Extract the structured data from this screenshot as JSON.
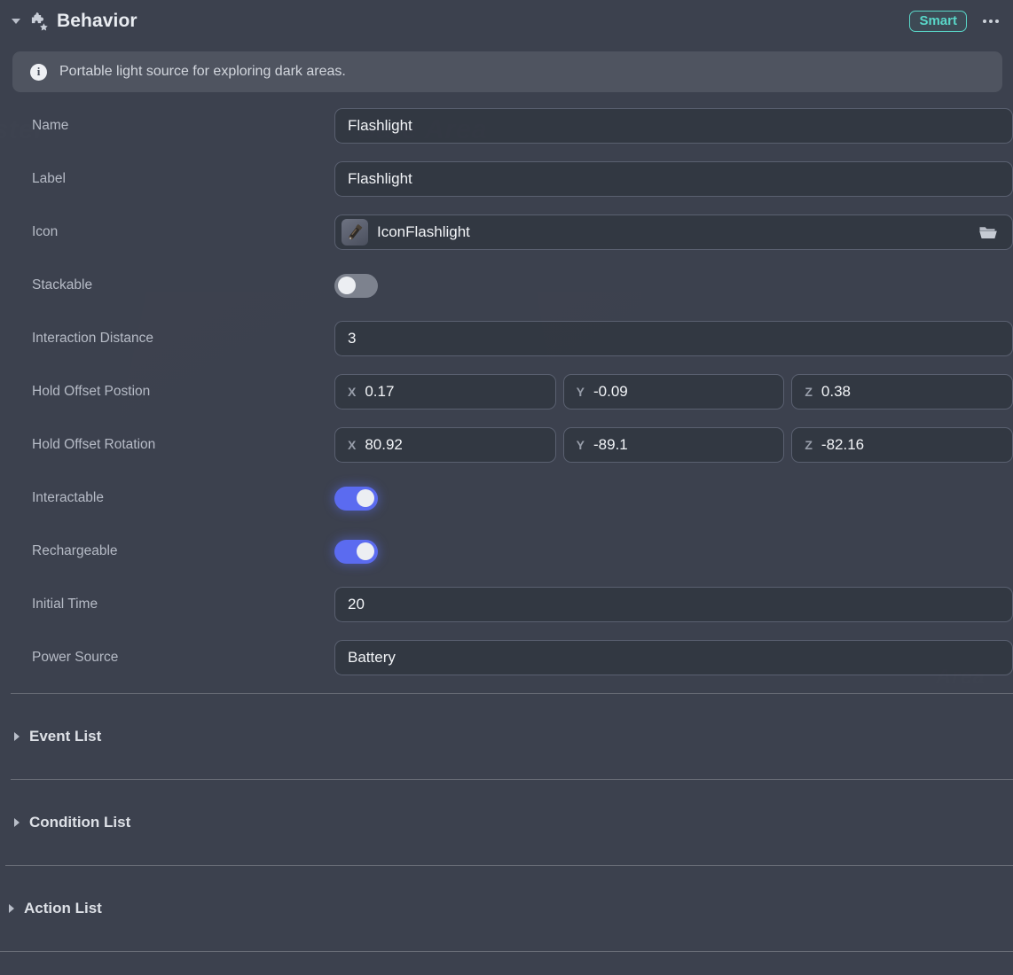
{
  "header": {
    "title": "Behavior",
    "collapse_icon": "chevron-down-icon",
    "component_icon": "puzzle-star-icon",
    "smart_badge": "Smart",
    "more_icon": "ellipsis-icon",
    "accent_color": "#59d6c8"
  },
  "info": {
    "icon": "info-icon",
    "text": "Portable light source for exploring dark areas."
  },
  "properties": [
    {
      "label": "Name",
      "type": "text",
      "value": "Flashlight"
    },
    {
      "label": "Label",
      "type": "text",
      "value": "Flashlight"
    },
    {
      "label": "Icon",
      "type": "asset",
      "value": "IconFlashlight",
      "thumb_icon": "flashlight-thumbnail",
      "browse_icon": "folder-icon"
    },
    {
      "label": "Stackable",
      "type": "toggle",
      "value": false
    },
    {
      "label": "Interaction Distance",
      "type": "text",
      "value": "3"
    },
    {
      "label": "Hold Offset Postion",
      "type": "vector",
      "axes": [
        "X",
        "Y",
        "Z"
      ],
      "values": [
        "0.17",
        "-0.09",
        "0.38"
      ]
    },
    {
      "label": "Hold Offset Rotation",
      "type": "vector",
      "axes": [
        "X",
        "Y",
        "Z"
      ],
      "values": [
        "80.92",
        "-89.1",
        "-82.16"
      ]
    },
    {
      "label": "Interactable",
      "type": "toggle",
      "value": true
    },
    {
      "label": "Rechargeable",
      "type": "toggle",
      "value": true
    },
    {
      "label": "Initial Time",
      "type": "text",
      "value": "20"
    },
    {
      "label": "Power Source",
      "type": "text",
      "value": "Battery"
    }
  ],
  "sections": [
    {
      "title": "Event List",
      "expanded": false,
      "indent": 16
    },
    {
      "title": "Condition List",
      "expanded": false,
      "indent": 16
    },
    {
      "title": "Action List",
      "expanded": false,
      "indent": 10
    }
  ],
  "background_watermarks": {
    "safe_area": "Safe Area",
    "partial_left": "ster",
    "partial_low": "Area"
  },
  "colors": {
    "panel_bg": "#3c414e",
    "input_bg": "#2f343f",
    "toggle_on": "#5b6bf0",
    "toggle_off": "#7d828e",
    "accent": "#59d6c8",
    "label_text": "#b6bbc6",
    "value_text": "#f2f4f7"
  }
}
